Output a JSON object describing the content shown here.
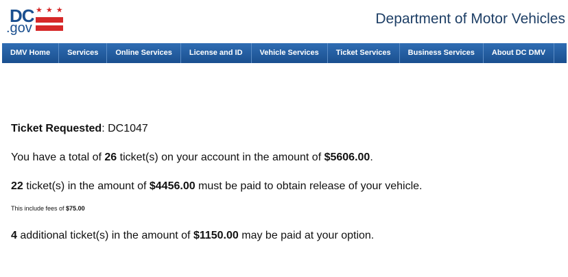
{
  "logo": {
    "dc": "DC",
    "gov": ".gov",
    "stars": "★★★"
  },
  "header": {
    "title": "Department of Motor Vehicles"
  },
  "nav": [
    "DMV Home",
    "Services",
    "Online Services",
    "License and ID",
    "Vehicle Services",
    "Ticket Services",
    "Business Services",
    "About DC DMV"
  ],
  "ticket": {
    "requested_label": "Ticket Requested",
    "requested_sep": ": ",
    "requested_value": "DC1047",
    "total_prefix": "You have a total of ",
    "total_count": "26",
    "total_middle": " ticket(s) on your account in the amount of ",
    "total_amount": "$5606.00",
    "total_suffix": ".",
    "release_count": "22",
    "release_middle": " ticket(s) in the amount of ",
    "release_amount": "$4456.00",
    "release_suffix": " must be paid to obtain release of your vehicle.",
    "fees_prefix": "This include fees of ",
    "fees_amount": "$75.00",
    "additional_count": "4",
    "additional_middle": " additional ticket(s) in the amount of ",
    "additional_amount": "$1150.00",
    "additional_suffix": " may be paid at your option."
  }
}
